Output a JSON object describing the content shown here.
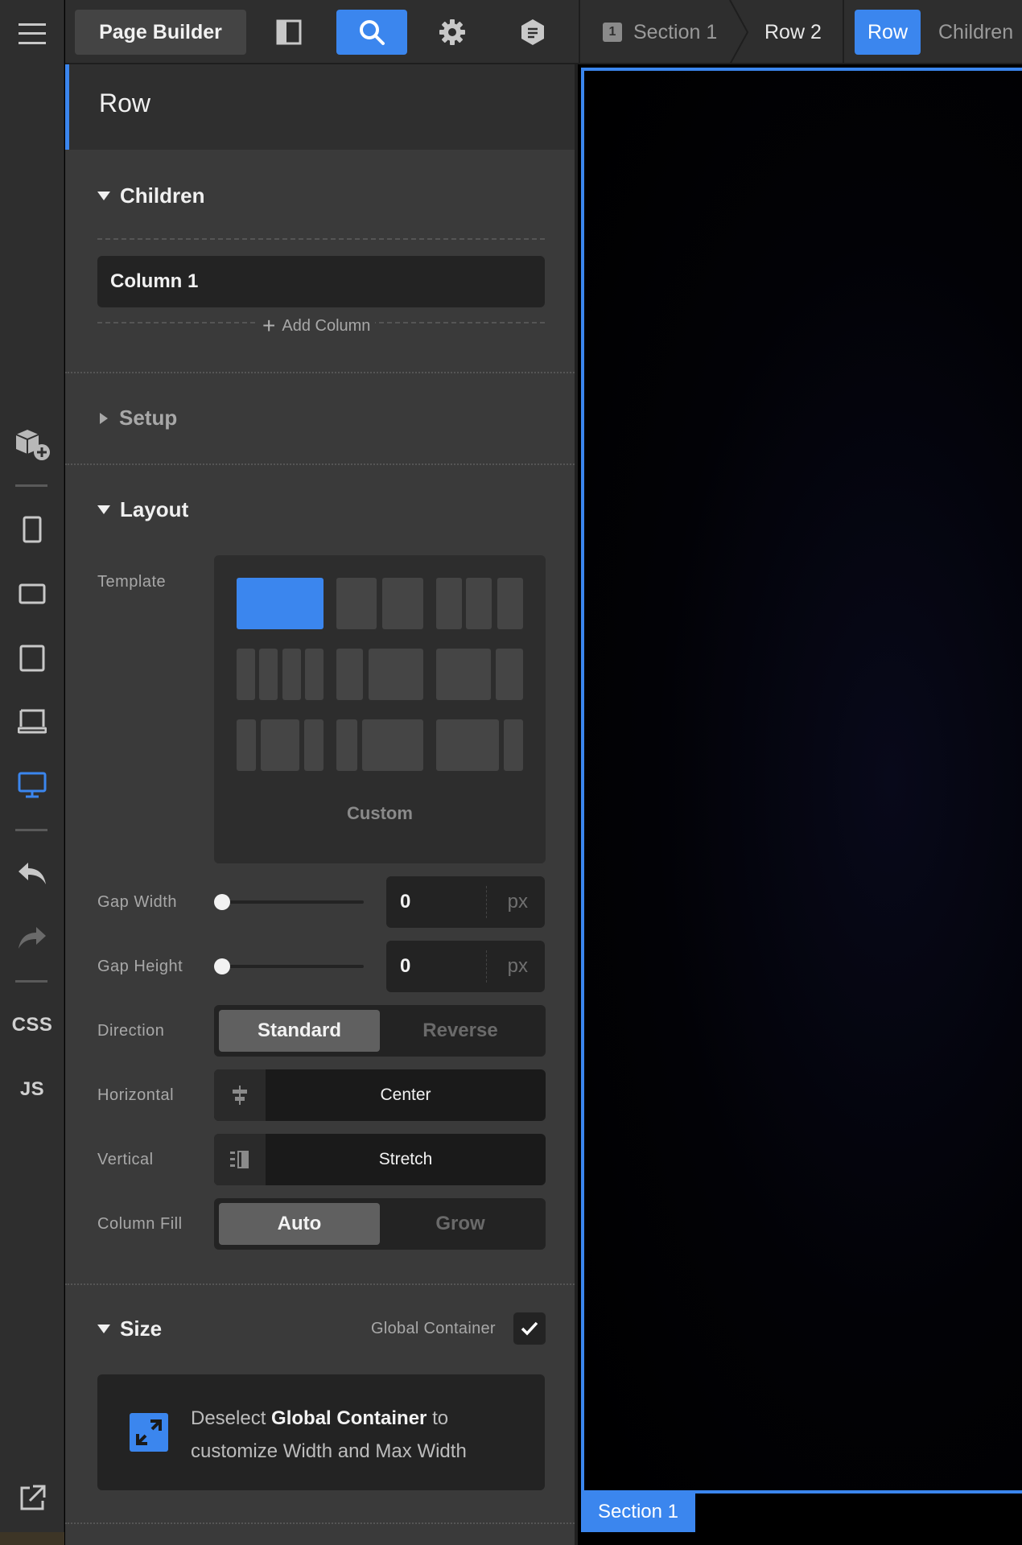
{
  "topbar": {
    "app_button": "Page Builder",
    "breadcrumbs": {
      "section_number": "1",
      "section": "Section 1",
      "row": "Row 2",
      "active": "Row",
      "next": "Children"
    }
  },
  "rail": {
    "items": [
      "hamburger-menu",
      "add-element",
      "phone-portrait",
      "phone-landscape",
      "tablet",
      "laptop",
      "desktop",
      "undo",
      "redo",
      "css",
      "js",
      "external-link"
    ],
    "css_label": "CSS",
    "js_label": "JS"
  },
  "panel": {
    "title": "Row",
    "children": {
      "title": "Children",
      "items": [
        "Column 1"
      ],
      "add_label": "Add Column"
    },
    "setup": {
      "title": "Setup"
    },
    "layout": {
      "title": "Layout",
      "template_label": "Template",
      "template_custom": "Custom",
      "gap_width_label": "Gap Width",
      "gap_width_value": "0",
      "gap_height_label": "Gap Height",
      "gap_height_value": "0",
      "unit": "px",
      "direction_label": "Direction",
      "direction_options": [
        "Standard",
        "Reverse"
      ],
      "direction_selected": "Standard",
      "horizontal_label": "Horizontal",
      "horizontal_value": "Center",
      "vertical_label": "Vertical",
      "vertical_value": "Stretch",
      "column_fill_label": "Column Fill",
      "column_fill_options": [
        "Auto",
        "Grow"
      ],
      "column_fill_selected": "Auto"
    },
    "size": {
      "title": "Size",
      "global_container_label": "Global Container",
      "global_container_checked": true,
      "info_prefix": "Deselect ",
      "info_bold": "Global Container",
      "info_suffix": " to customize Width and Max Width"
    }
  },
  "canvas": {
    "section_tag": "Section 1"
  },
  "colors": {
    "accent": "#3b86ee",
    "panel_bg": "#3a3a3a",
    "rail_bg": "#2e2e2e"
  }
}
